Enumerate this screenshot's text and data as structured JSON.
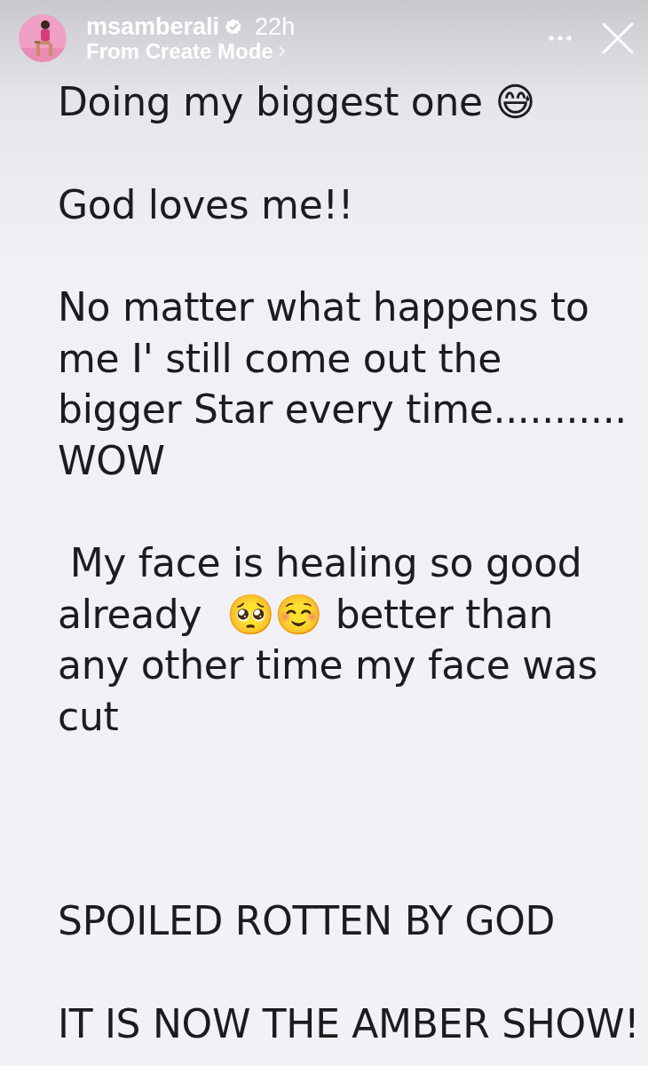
{
  "header": {
    "username": "msamberali",
    "verified": true,
    "time": "22h",
    "subtitle": "From Create Mode"
  },
  "story": {
    "paragraphs": [
      [
        "Doing my biggest one 😅"
      ],
      [
        "God loves me!!"
      ],
      [
        "No matter what happens to",
        "me I' still come out the",
        "bigger Star every time...........",
        "WOW"
      ],
      [
        " My face is healing so good",
        "already  🥺☺️ better than",
        "any other time my face was",
        "cut"
      ],
      [
        "SPOILED ROTTEN BY GOD"
      ],
      [
        "IT IS NOW THE AMBER SHOW!"
      ]
    ]
  }
}
